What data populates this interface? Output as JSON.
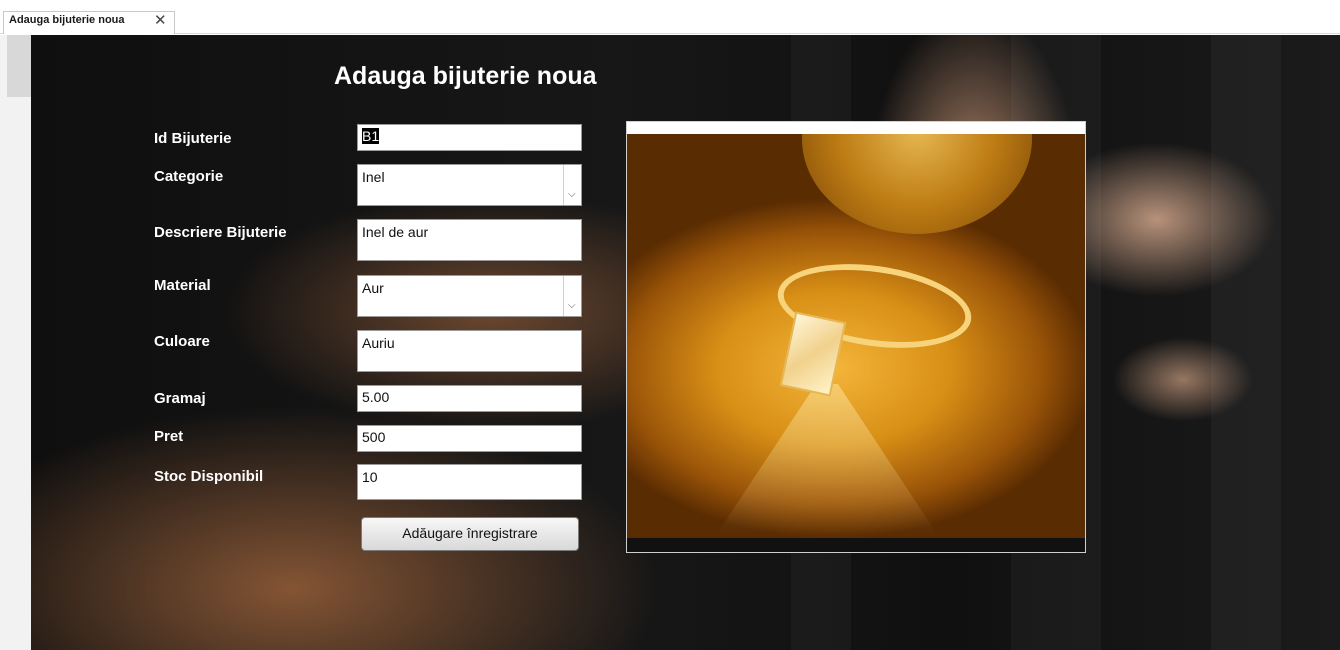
{
  "tab": {
    "title": "Adauga bijuterie noua",
    "close_glyph": "✕"
  },
  "form": {
    "title": "Adauga bijuterie noua",
    "fields": {
      "id": {
        "label": "Id Bijuterie",
        "value": "B1"
      },
      "categorie": {
        "label": "Categorie",
        "value": "Inel"
      },
      "descriere": {
        "label": "Descriere Bijuterie",
        "value": "Inel de aur"
      },
      "material": {
        "label": "Material",
        "value": "Aur"
      },
      "culoare": {
        "label": "Culoare",
        "value": "Auriu"
      },
      "gramaj": {
        "label": "Gramaj",
        "value": "5.00"
      },
      "pret": {
        "label": "Pret",
        "value": "500"
      },
      "stoc": {
        "label": "Stoc Disponibil",
        "value": "10"
      }
    },
    "add_button_label": "Adăugare înregistrare",
    "dropdown_glyph": "⌵"
  },
  "colors": {
    "label_text": "#ffffff",
    "background": "#141414",
    "photo_accent": "#d88f16"
  },
  "icons": {
    "tab_close": "close-icon",
    "combo": "chevron-down-icon"
  }
}
